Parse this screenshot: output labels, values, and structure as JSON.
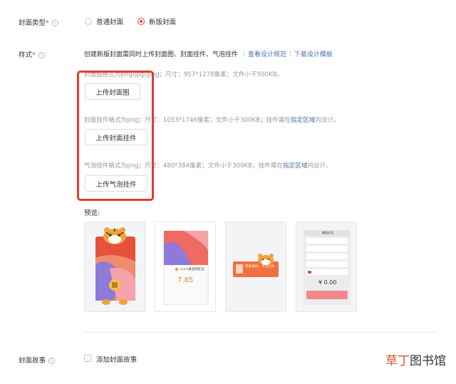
{
  "cover_type": {
    "label": "封面类型",
    "required_mark": "*",
    "options": [
      {
        "label": "普通封面",
        "selected": false
      },
      {
        "label": "新版封面",
        "selected": true
      }
    ]
  },
  "style": {
    "label": "样式",
    "required_mark": "*",
    "intro": "创建新版封面需同时上传封面图、封面挂件、气泡挂件",
    "link_spec": "查看设计规范",
    "link_download": "下载设计模板",
    "cover_hint": "封面图格式为png/jpg/jpeg；尺寸：957*1278像素；文件小于500KB。",
    "cover_button": "上传封面图",
    "pendant_hint_pre": "封面挂件格式为png；尺寸：1053*1746像素；文件小于300KB；挂件需在",
    "pendant_hint_link": "指定区域",
    "pendant_hint_post": "内设计。",
    "pendant_button": "上传封面挂件",
    "bubble_hint_pre": "气泡挂件格式为png；尺寸：480*384像素；文件小于300KB；挂件需在",
    "bubble_hint_link": "指定区域",
    "bubble_hint_post": "内设计。",
    "bubble_button": "上传气泡挂件"
  },
  "preview": {
    "label": "预览:",
    "card2_title": "×××发出的红包",
    "card2_amount": "7.85",
    "card3_text": "恭喜发财，大吉大利",
    "card4_header": "微信红包",
    "card4_amount": "¥ 0.00"
  },
  "cover_story": {
    "label": "封面故事",
    "checkbox_label": "添加封面故事"
  },
  "watermark": {
    "hi": "草丁",
    "rest": "图书馆"
  },
  "colors": {
    "accent": "#e8483b",
    "link": "#4a6fb0",
    "highlight_box": "#e53935"
  }
}
